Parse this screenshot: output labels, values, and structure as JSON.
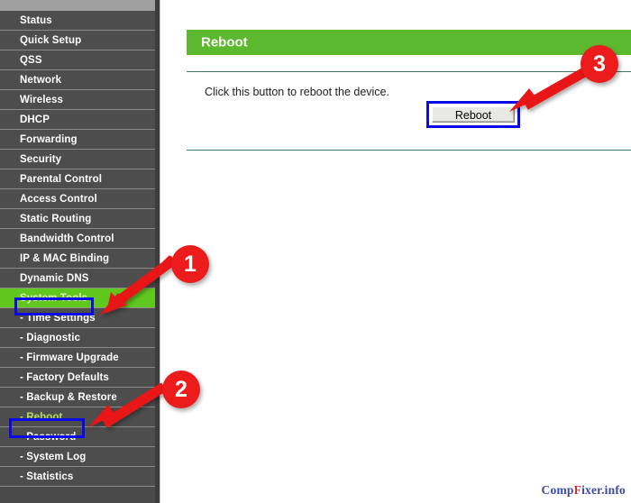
{
  "sidebar": {
    "items": [
      {
        "label": "Status",
        "type": "main",
        "state": "normal"
      },
      {
        "label": "Quick Setup",
        "type": "main",
        "state": "normal"
      },
      {
        "label": "QSS",
        "type": "main",
        "state": "normal"
      },
      {
        "label": "Network",
        "type": "main",
        "state": "normal"
      },
      {
        "label": "Wireless",
        "type": "main",
        "state": "normal"
      },
      {
        "label": "DHCP",
        "type": "main",
        "state": "normal"
      },
      {
        "label": "Forwarding",
        "type": "main",
        "state": "normal"
      },
      {
        "label": "Security",
        "type": "main",
        "state": "normal"
      },
      {
        "label": "Parental Control",
        "type": "main",
        "state": "normal"
      },
      {
        "label": "Access Control",
        "type": "main",
        "state": "normal"
      },
      {
        "label": "Static Routing",
        "type": "main",
        "state": "normal"
      },
      {
        "label": "Bandwidth Control",
        "type": "main",
        "state": "normal"
      },
      {
        "label": "IP & MAC Binding",
        "type": "main",
        "state": "normal"
      },
      {
        "label": "Dynamic DNS",
        "type": "main",
        "state": "normal"
      },
      {
        "label": "System Tools",
        "type": "main",
        "state": "highlighted"
      },
      {
        "label": "- Time Settings",
        "type": "sub",
        "state": "normal"
      },
      {
        "label": "- Diagnostic",
        "type": "sub",
        "state": "normal"
      },
      {
        "label": "- Firmware Upgrade",
        "type": "sub",
        "state": "normal"
      },
      {
        "label": "- Factory Defaults",
        "type": "sub",
        "state": "normal"
      },
      {
        "label": "- Backup & Restore",
        "type": "sub",
        "state": "normal"
      },
      {
        "label": "- Reboot",
        "type": "sub",
        "state": "selected"
      },
      {
        "label": "- Password",
        "type": "sub",
        "state": "normal"
      },
      {
        "label": "- System Log",
        "type": "sub",
        "state": "normal"
      },
      {
        "label": "- Statistics",
        "type": "sub",
        "state": "normal"
      }
    ]
  },
  "main": {
    "page_title": "Reboot",
    "instruction": "Click this button to reboot the device.",
    "reboot_button_label": "Reboot"
  },
  "annotations": {
    "callouts": [
      {
        "number": "1",
        "points_to": "System Tools menu item"
      },
      {
        "number": "2",
        "points_to": "Reboot submenu item"
      },
      {
        "number": "3",
        "points_to": "Reboot button"
      }
    ]
  },
  "watermark": {
    "prefix": "Comp",
    "accent": "F",
    "suffix": "ixer.info"
  },
  "colors": {
    "sidebar_bg": "#4d4d4d",
    "highlight_green": "#5fc71e",
    "header_green": "#5cb82e",
    "selection_blue": "#0a0ae6",
    "callout_red": "#ec1c1c",
    "rule_green": "#3f7a5e"
  }
}
